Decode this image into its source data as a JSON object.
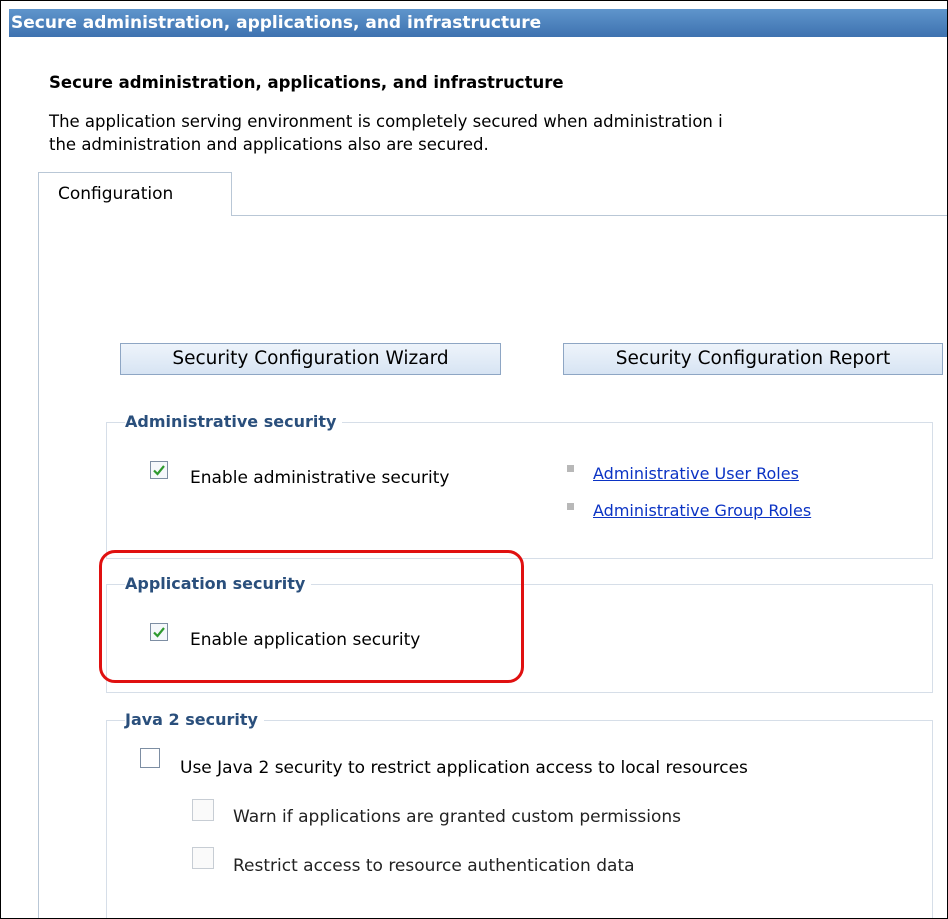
{
  "window": {
    "title": "Secure administration, applications, and infrastructure"
  },
  "page": {
    "heading": "Secure administration, applications, and infrastructure",
    "description_lines": [
      "The application serving environment is completely secured when administration i",
      "the administration and applications also are secured."
    ]
  },
  "tabs": [
    {
      "label": "Configuration",
      "active": true
    }
  ],
  "buttons": {
    "wizard": "Security Configuration Wizard",
    "report": "Security Configuration Report"
  },
  "administrative_security": {
    "legend": "Administrative security",
    "checkbox": {
      "label": "Enable administrative security",
      "checked": true
    },
    "links": [
      "Administrative User Roles",
      "Administrative Group Roles"
    ]
  },
  "application_security": {
    "legend": "Application security",
    "checkbox": {
      "label": "Enable application security",
      "checked": true
    }
  },
  "java2_security": {
    "legend": "Java 2 security",
    "main_checkbox": {
      "label": "Use Java 2 security to restrict application access to local resources",
      "checked": false
    },
    "sub_checkboxes": [
      {
        "label": "Warn if applications are granted custom permissions",
        "checked": false,
        "enabled": false
      },
      {
        "label": "Restrict access to resource authentication data",
        "checked": false,
        "enabled": false
      }
    ]
  },
  "colors": {
    "title_bar": "#4a80bf",
    "legend_text": "#2a4f7c",
    "link": "#0b33c4",
    "highlight": "#e01010"
  }
}
